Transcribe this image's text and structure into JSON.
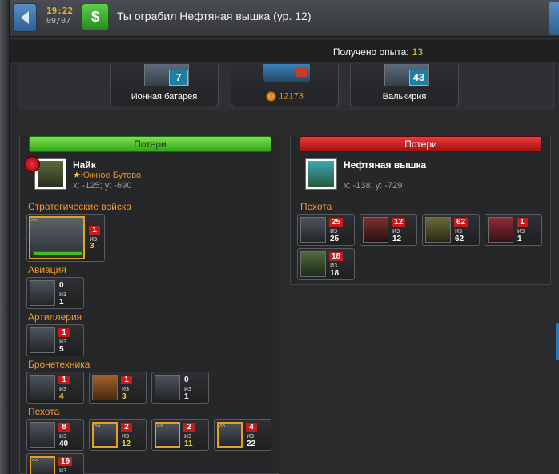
{
  "header": {
    "time": "19:22",
    "date": "09/07",
    "title": "Ты ограбил Нефтяная вышка (ур. 12)"
  },
  "experience": {
    "label": "Получено опыта:",
    "value": "13"
  },
  "loot": [
    {
      "label": "Ионная батарея",
      "count": "7"
    },
    {
      "label": "12173",
      "icon": "coin-icon"
    },
    {
      "label": "Валькирия",
      "count": "43"
    }
  ],
  "attacker": {
    "header": "Потери",
    "name": "Найк",
    "alliance": "Южное Бутово",
    "coords": "x: -125; y: -690",
    "sections": [
      {
        "title": "Стратегические войска",
        "units": [
          {
            "lost": "1",
            "total": "3"
          }
        ]
      },
      {
        "title": "Авиация",
        "units": [
          {
            "lost": "0",
            "total": "1"
          }
        ]
      },
      {
        "title": "Артиллерия",
        "units": [
          {
            "lost": "1",
            "total": "5"
          }
        ]
      },
      {
        "title": "Бронетехника",
        "units": [
          {
            "lost": "1",
            "total": "4"
          },
          {
            "lost": "1",
            "total": "3"
          },
          {
            "lost": "0",
            "total": "1"
          }
        ]
      },
      {
        "title": "Пехота",
        "units": [
          {
            "lost": "8",
            "total": "40"
          },
          {
            "lost": "2",
            "total": "12"
          },
          {
            "lost": "2",
            "total": "11"
          },
          {
            "lost": "4",
            "total": "22"
          },
          {
            "lost": "19",
            "total": ""
          }
        ]
      }
    ]
  },
  "defender": {
    "header": "Потери",
    "name": "Нефтяная вышка",
    "coords": "x: -138; y: -729",
    "sections": [
      {
        "title": "Пехота",
        "units": [
          {
            "lost": "25",
            "total": "25"
          },
          {
            "lost": "12",
            "total": "12"
          },
          {
            "lost": "62",
            "total": "62"
          },
          {
            "lost": "1",
            "total": "1"
          },
          {
            "lost": "18",
            "total": "18"
          }
        ]
      }
    ]
  },
  "of_label": "из",
  "colors": {
    "accent_orange": "#f39a2a",
    "loss_red": "#c41b1b",
    "header_green": "#2fa61a",
    "header_red": "#a20f0f"
  }
}
